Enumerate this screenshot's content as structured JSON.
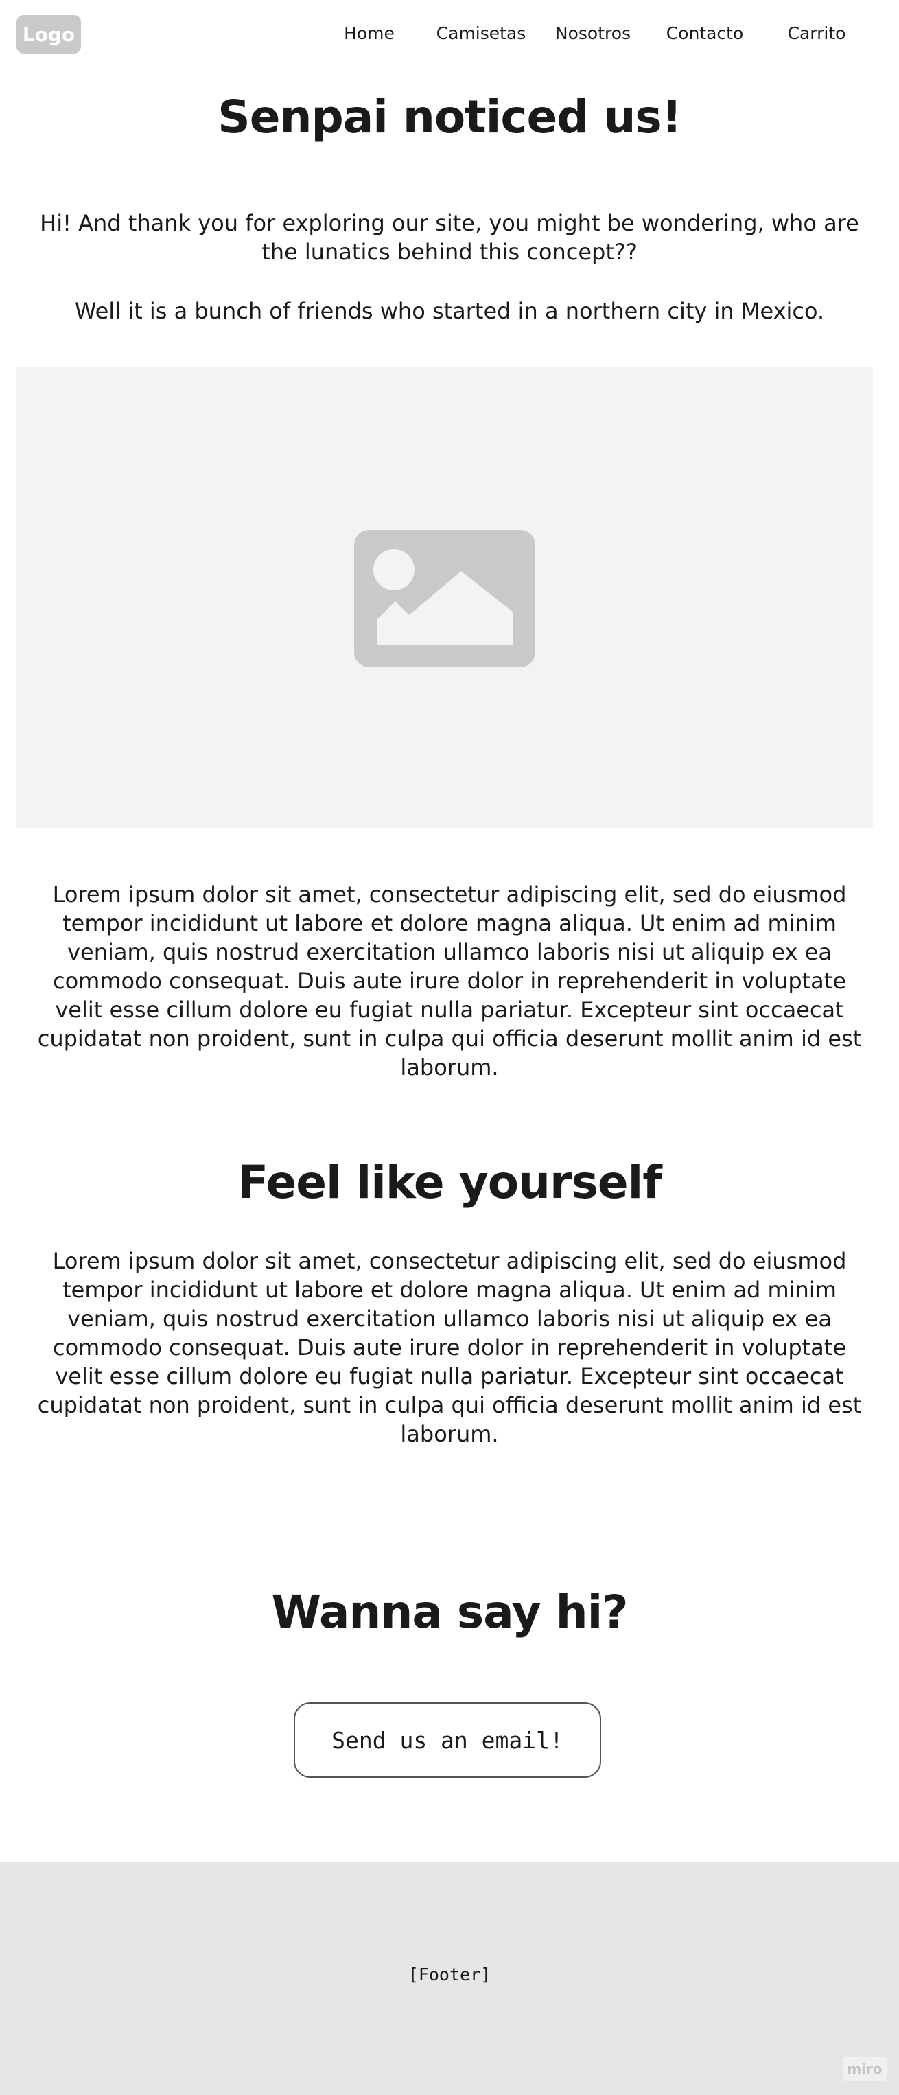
{
  "nav": {
    "logo": "Logo",
    "links": [
      "Home",
      "Camisetas",
      "Nosotros",
      "Contacto",
      "Carrito"
    ]
  },
  "hero": {
    "title": "Senpai noticed us!",
    "intro": "Hi! And thank you for exploring our site, you might be wondering, who are the lunatics behind this concept??",
    "intro2": "Well it is a bunch of friends who started in a northern city in Mexico.",
    "image_icon": "image-placeholder-icon"
  },
  "about": {
    "body": "Lorem ipsum dolor sit amet, consectetur adipiscing elit, sed do eiusmod tempor incididunt ut labore et dolore magna aliqua. Ut enim ad minim veniam, quis nostrud exercitation ullamco laboris nisi ut aliquip ex ea commodo consequat. Duis aute irure dolor in reprehenderit in voluptate velit esse cillum dolore eu fugiat nulla pariatur. Excepteur sint occaecat cupidatat non proident, sunt in culpa qui officia deserunt mollit anim id est laborum."
  },
  "feel": {
    "title": "Feel like yourself",
    "body": "Lorem ipsum dolor sit amet, consectetur adipiscing elit, sed do eiusmod tempor incididunt ut labore et dolore magna aliqua. Ut enim ad minim veniam, quis nostrud exercitation ullamco laboris nisi ut aliquip ex ea commodo consequat. Duis aute irure dolor in reprehenderit in voluptate velit esse cillum dolore eu fugiat nulla pariatur. Excepteur sint occaecat cupidatat non proident, sunt in culpa qui officia deserunt mollit anim id est laborum."
  },
  "contact": {
    "title": "Wanna say hi?",
    "button": "Send us an email!"
  },
  "footer": {
    "label": "[Footer]",
    "badge": "miro"
  },
  "colors": {
    "text": "#1a1a1a",
    "logo_bg": "#c9c9c9",
    "image_bg": "#f3f3f3",
    "image_icon": "#c9c9c9",
    "footer_bg": "#e5e5e5"
  }
}
